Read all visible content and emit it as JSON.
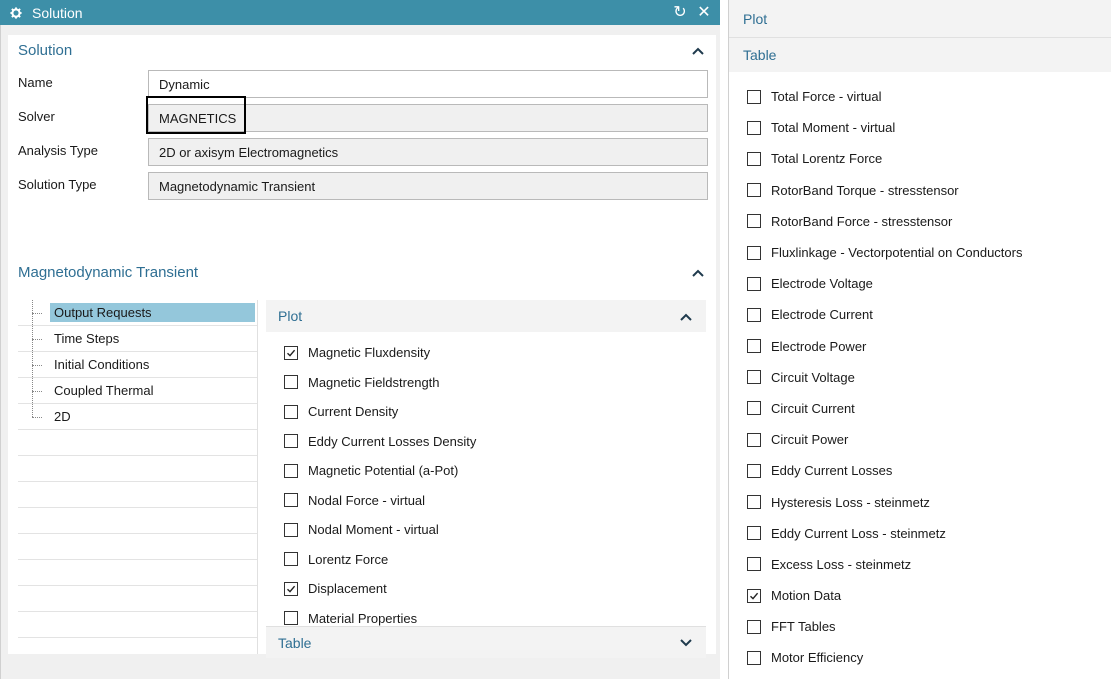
{
  "dialog": {
    "title": "Solution",
    "icons": {
      "title": "gear-icon",
      "reset": "reset-icon",
      "close": "close-icon"
    },
    "reset_glyph": "↻",
    "close_glyph": "✕"
  },
  "solution_group": {
    "header": "Solution",
    "chevron": "^",
    "fields": [
      {
        "label": "Name",
        "value": "Dynamic"
      },
      {
        "label": "Solver",
        "value": "MAGNETICS"
      },
      {
        "label": "Analysis Type",
        "value": "2D or axisym Electromagnetics"
      },
      {
        "label": "Solution Type",
        "value": "Magnetodynamic Transient"
      }
    ]
  },
  "transient_group": {
    "header": "Magnetodynamic Transient",
    "chevron": "^",
    "tree": [
      "Output Requests",
      "Time Steps",
      "Initial Conditions",
      "Coupled Thermal",
      "2D"
    ],
    "selected_tree_item": "Output Requests",
    "plot_header": "Plot",
    "plot_chevron": "^",
    "plot_options": [
      {
        "label": "Magnetic Fluxdensity",
        "checked": true
      },
      {
        "label": "Magnetic Fieldstrength",
        "checked": false
      },
      {
        "label": "Current Density",
        "checked": false
      },
      {
        "label": "Eddy Current Losses Density",
        "checked": false
      },
      {
        "label": "Magnetic Potential (a-Pot)",
        "checked": false
      },
      {
        "label": "Nodal Force - virtual",
        "checked": false
      },
      {
        "label": "Nodal Moment - virtual",
        "checked": false
      },
      {
        "label": "Lorentz Force",
        "checked": false
      },
      {
        "label": "Displacement",
        "checked": true
      },
      {
        "label": "Material Properties",
        "checked": false
      }
    ],
    "table_header": "Table",
    "table_chevron": "v"
  },
  "right_panel": {
    "plot_header": "Plot",
    "table_header": "Table",
    "table_options": [
      {
        "label": "Total Force - virtual",
        "checked": false
      },
      {
        "label": "Total Moment - virtual",
        "checked": false
      },
      {
        "label": "Total Lorentz Force",
        "checked": false
      },
      {
        "label": "RotorBand Torque - stresstensor",
        "checked": false
      },
      {
        "label": "RotorBand Force - stresstensor",
        "checked": false
      },
      {
        "label": "Fluxlinkage - Vectorpotential on Conductors",
        "checked": false
      },
      {
        "label": "Electrode Voltage",
        "checked": false
      },
      {
        "label": "Electrode Current",
        "checked": false
      },
      {
        "label": "Electrode Power",
        "checked": false
      },
      {
        "label": "Circuit Voltage",
        "checked": false
      },
      {
        "label": "Circuit Current",
        "checked": false
      },
      {
        "label": "Circuit Power",
        "checked": false
      },
      {
        "label": "Eddy Current Losses",
        "checked": false
      },
      {
        "label": "Hysteresis Loss - steinmetz",
        "checked": false
      },
      {
        "label": "Eddy Current Loss - steinmetz",
        "checked": false
      },
      {
        "label": "Excess Loss - steinmetz",
        "checked": false
      },
      {
        "label": "Motion Data",
        "checked": true
      },
      {
        "label": "FFT Tables",
        "checked": false
      },
      {
        "label": "Motor Efficiency",
        "checked": false
      }
    ]
  },
  "colors": {
    "titlebar": "#3d8fa8",
    "header_text": "#2f6f93",
    "selection": "#94c7db"
  }
}
